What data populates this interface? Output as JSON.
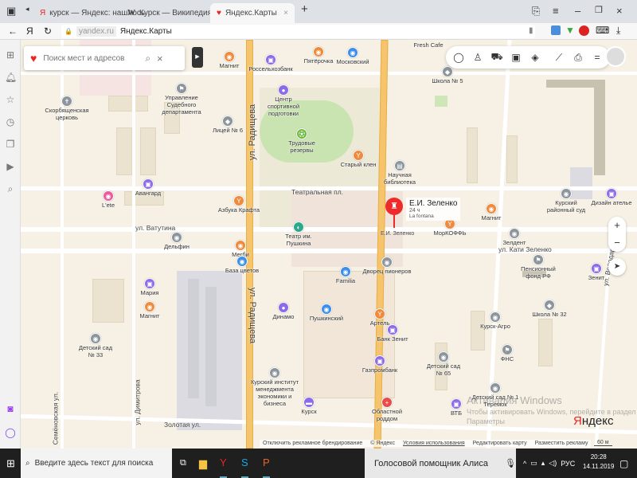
{
  "browser": {
    "tabs": [
      {
        "label": "курск — Яндекс: нашлось",
        "icon": "yandex-icon"
      },
      {
        "label": "Курск — Википедия",
        "icon": "wikipedia-icon"
      },
      {
        "label": "Яндекс.Карты",
        "icon": "maps-pin-icon"
      }
    ],
    "new_tab": "+",
    "close_tab": "×",
    "yandex_btn": "Я",
    "domain": "yandex.ru",
    "page_title": "Яндекс.Карты",
    "window": {
      "minimize": "–",
      "restore": "❐",
      "close": "×"
    }
  },
  "search": {
    "placeholder": "Поиск мест и адресов"
  },
  "selected": {
    "name": "Е.И. Зеленко",
    "hours": "24 ч",
    "sub": "La fontana",
    "pin_label": "Е.И. Зеленко",
    "color": "#ee2a2a"
  },
  "streets": [
    "ул. Радищева",
    "ул. Радищева",
    "Театральная пл.",
    "ул. Ватутина",
    "ул. Кати Зеленко",
    "ул. Димитрова",
    "Золотая ул.",
    "Семёновская ул.",
    "ул. Володарского"
  ],
  "pois": [
    "Магнит",
    "Пятёрочка",
    "Московский",
    "Россельхозбанк",
    "Центр спортивной подготовки",
    "Трудовые резервы",
    "Старый клен",
    "Научная библиотека",
    "Школа № 5",
    "Fresh Cafe",
    "Управление Судебного департамента",
    "Скорбященская церковь",
    "Лицей № 6",
    "Авангард",
    "L'ete",
    "Азбука Крафта",
    "Дельфин",
    "Мегби",
    "База цветов",
    "Театр им. Пушкина",
    "Familia",
    "Дворец пионеров",
    "Мария",
    "Магнит",
    "Динамо",
    "Пушкинский",
    "Детский сад № 33",
    "Курский институт менеджмента экономики и бизнеса",
    "Курск",
    "Артель",
    "Банк Зенит",
    "Газпромбанк",
    "Детский сад № 65",
    "Курск-Агро",
    "ФНС",
    "Школа № 32",
    "Пенсионный фонд РФ",
    "Зенит",
    "Зелдент",
    "МорКОФФЬ",
    "Магнит",
    "Курский районный суд",
    "Дизайн ателье",
    "Областной роддом",
    "ВТБ",
    "Детский сад № 1 Теремок"
  ],
  "colors": {
    "orange": "#f08a3c",
    "blue": "#3d8ee8",
    "purple": "#8d6ae8",
    "gray": "#8c949c",
    "green": "#6cbb3c",
    "pink": "#e85c9c",
    "teal": "#2ea88a",
    "red": "#e94a4a"
  },
  "zoom": {
    "in": "+",
    "out": "−"
  },
  "footer": {
    "branding": "Отключить рекламное брендирование",
    "copyright": "© Яндекс",
    "terms": "Условия использования",
    "edit": "Редактировать карту",
    "ads": "Разместить рекламу",
    "scale": "60 м",
    "logo": "Яндекс"
  },
  "watermark": {
    "title": "Активация Windows",
    "text": "Чтобы активировать Windows, перейдите в раздел",
    "text2": "Параметры"
  },
  "taskbar": {
    "search_placeholder": "Введите здесь текст для поиска",
    "alice": "Голосовой помощник Алиса",
    "lang": "РУС",
    "time": "20:28",
    "date": "14.11.2019"
  }
}
